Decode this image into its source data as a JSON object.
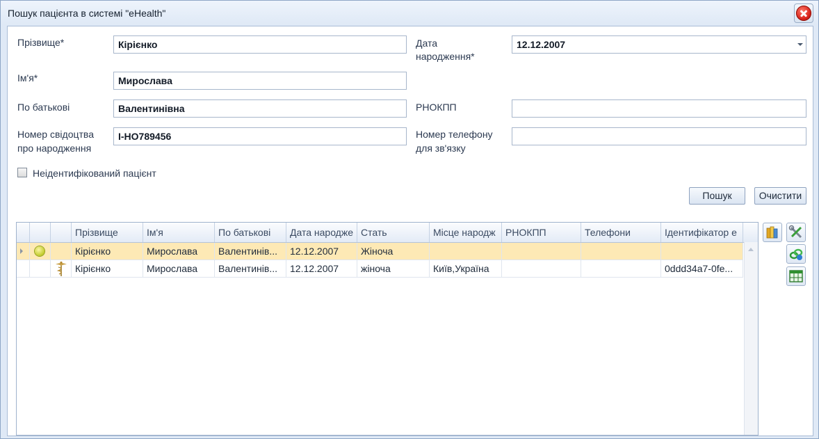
{
  "window": {
    "title": "Пошук пацієнта в системі \"eHealth\""
  },
  "form": {
    "surname_label": "Прізвище*",
    "surname_value": "Кірієнко",
    "birthdate_label_line1": "Дата",
    "birthdate_label_line2": "народження*",
    "birthdate_value": "12.12.2007",
    "name_label": "Ім'я*",
    "name_value": "Мирослава",
    "patronymic_label": "По батькові",
    "patronymic_value": "Валентинівна",
    "rnokpp_label": "РНОКПП",
    "rnokpp_value": "",
    "certificate_label_line1": "Номер свідоцтва",
    "certificate_label_line2": "про народження",
    "certificate_value": "І-НО789456",
    "phone_label_line1": "Номер телефону",
    "phone_label_line2": "для зв'язку",
    "phone_value": "",
    "unidentified_label": "Неідентифікований пацієнт",
    "unidentified_checked": false
  },
  "buttons": {
    "search": "Пошук",
    "clear": "Очистити"
  },
  "table": {
    "columns": [
      "Прізвище",
      "Ім'я",
      "По батькові",
      "Дата народже",
      "Стать",
      "Місце народж",
      "РНОКПП",
      "Телефони",
      "Ідентифікатор е"
    ],
    "rows": [
      {
        "icon": "status-dot-icon",
        "selected": true,
        "cells": [
          "Кірієнко",
          "Мирослава",
          "Валентинів...",
          "12.12.2007",
          "Жіноча",
          "",
          "",
          "",
          ""
        ]
      },
      {
        "icon": "caduceus-icon",
        "selected": false,
        "cells": [
          "Кірієнко",
          "Мирослава",
          "Валентинів...",
          "12.12.2007",
          "жіноча",
          "Київ,Україна",
          "",
          "",
          "0ddd34a7-0fe..."
        ]
      }
    ]
  },
  "tools": [
    "books-icon",
    "tools-icon",
    "link-help-icon",
    "table-grid-icon"
  ],
  "colors": {
    "selected_row": "#fde9b5",
    "window_bg": "#dfe9f6",
    "close_red": "#d8231a"
  }
}
